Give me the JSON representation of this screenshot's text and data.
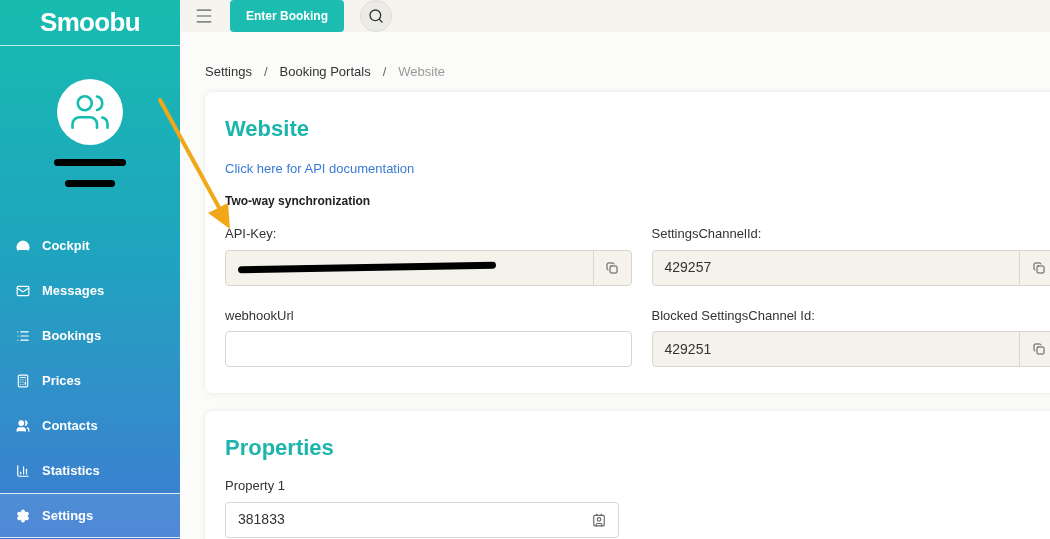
{
  "logo": "Smoobu",
  "header": {
    "button": "Enter Booking"
  },
  "sidebar": {
    "items": [
      {
        "label": "Cockpit",
        "selected": false
      },
      {
        "label": "Messages",
        "selected": false
      },
      {
        "label": "Bookings",
        "selected": false
      },
      {
        "label": "Prices",
        "selected": false
      },
      {
        "label": "Contacts",
        "selected": false
      },
      {
        "label": "Statistics",
        "selected": false
      },
      {
        "label": "Settings",
        "selected": true
      }
    ]
  },
  "breadcrumb": [
    {
      "label": "Settings",
      "current": false
    },
    {
      "separator": "/",
      "label": "Booking Portals",
      "current": false
    },
    {
      "separator": "/",
      "label": "Website",
      "current": true
    }
  ],
  "website": {
    "title": "Website",
    "link": "Click here for API documentation",
    "subtitle": "Two-way synchronization",
    "fields": [
      {
        "label": "API-Key:",
        "redacted": true,
        "copy": true
      },
      {
        "label": "SettingsChannelId:",
        "value": "429257",
        "copy": true
      },
      {
        "label": "webhookUrl",
        "copy": false
      },
      {
        "label": "Blocked SettingsChannel Id:",
        "value": "429251",
        "copy": true
      }
    ]
  },
  "properties": {
    "title": "Properties",
    "fields": [
      {
        "label": "Property 1",
        "value": "381833"
      }
    ]
  }
}
